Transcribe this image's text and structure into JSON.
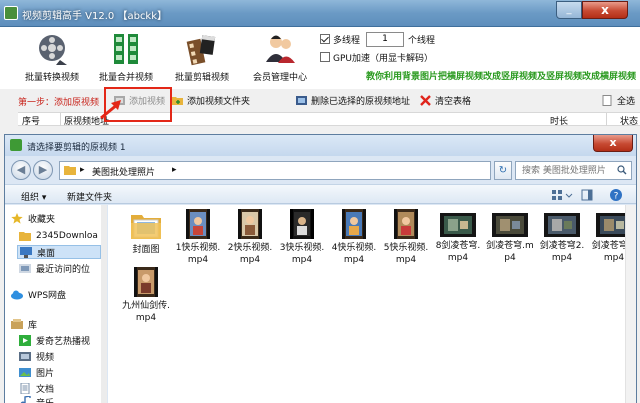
{
  "app": {
    "title": "视频剪辑高手 V12.0 【abckk】",
    "close_glyph": "x"
  },
  "toolbar": {
    "tools": [
      {
        "label": "批量转换视频",
        "icon": "film-reel-icon"
      },
      {
        "label": "批量合并视频",
        "icon": "film-strip-icon"
      },
      {
        "label": "批量剪辑视频",
        "icon": "clapper-film-icon"
      },
      {
        "label": "会员管理中心",
        "icon": "users-icon"
      }
    ],
    "multithread_label": "多线程",
    "multithread_checked": true,
    "thread_count": "1",
    "thread_unit": "个线程",
    "gpu_label": "GPU加速（用显卡解码）",
    "gpu_checked": false,
    "promo_text": "教你利用背景图片把横屏视频改成竖屏视频及竖屏视频改成横屏视频"
  },
  "steps": {
    "step1_label": "第一步：添加原视频",
    "add_video": "添加视频",
    "add_folder": "添加视频文件夹",
    "delete_selected": "删除已选择的原视频地址",
    "clear_table": "清空表格",
    "select_all": "全选"
  },
  "table": {
    "columns": [
      "序号",
      "原视频地址",
      "时长",
      "状态"
    ]
  },
  "dialog": {
    "title": "请选择要剪辑的原视频 1",
    "close_glyph": "x",
    "path_root": "▸",
    "path_folder": "美图批处理照片",
    "path_end": "▸",
    "search_placeholder": "搜索 美图批处理照片",
    "organize": "组织 ▾",
    "new_folder": "新建文件夹",
    "nav": [
      {
        "label": "收藏夹",
        "icon": "star-icon"
      },
      {
        "label": "2345Downloa",
        "icon": "folder-icon"
      },
      {
        "label": "桌面",
        "icon": "desktop-icon",
        "selected": true
      },
      {
        "label": "最近访问的位",
        "icon": "recent-icon"
      },
      {
        "label": "WPS网盘",
        "icon": "cloud-icon"
      },
      {
        "label": "库",
        "icon": "library-icon"
      },
      {
        "label": "爱奇艺热播视",
        "icon": "video-folder-icon"
      },
      {
        "label": "视频",
        "icon": "video-icon"
      },
      {
        "label": "图片",
        "icon": "picture-icon"
      },
      {
        "label": "文档",
        "icon": "document-icon"
      },
      {
        "label": "音乐",
        "icon": "music-icon"
      }
    ],
    "files": [
      {
        "name": "封面图",
        "kind": "folder"
      },
      {
        "name": "1快乐视频.mp4",
        "kind": "video"
      },
      {
        "name": "2快乐视频.mp4",
        "kind": "video"
      },
      {
        "name": "3快乐视频.mp4",
        "kind": "video"
      },
      {
        "name": "4快乐视频.mp4",
        "kind": "video"
      },
      {
        "name": "5快乐视频.mp4",
        "kind": "video"
      },
      {
        "name": "8剑凌苍穹.mp4",
        "kind": "filmstrip"
      },
      {
        "name": "剑凌苍穹.mp4",
        "kind": "filmstrip"
      },
      {
        "name": "剑凌苍穹2.mp4",
        "kind": "filmstrip"
      },
      {
        "name": "剑凌苍穹5.mp4",
        "kind": "filmstrip"
      },
      {
        "name": "九州仙剑传.mp4",
        "kind": "video"
      }
    ]
  },
  "colors": {
    "highlight": "#e32717",
    "promo": "#2a9a1f",
    "step": "#c8241c"
  }
}
